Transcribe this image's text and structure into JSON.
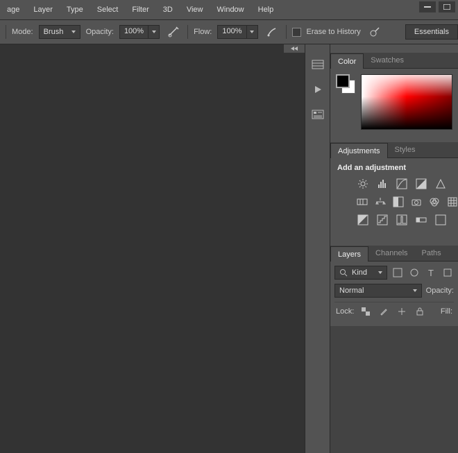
{
  "menu": {
    "items": [
      "age",
      "Layer",
      "Type",
      "Select",
      "Filter",
      "3D",
      "View",
      "Window",
      "Help"
    ]
  },
  "optbar": {
    "mode_label": "Mode:",
    "mode_value": "Brush",
    "opacity_label": "Opacity:",
    "opacity_value": "100%",
    "flow_label": "Flow:",
    "flow_value": "100%",
    "erase_label": "Erase to History",
    "workspace": "Essentials"
  },
  "panels": {
    "color_tabs": [
      "Color",
      "Swatches"
    ],
    "adj_tabs": [
      "Adjustments",
      "Styles"
    ],
    "adj_header": "Add an adjustment",
    "layer_tabs": [
      "Layers",
      "Channels",
      "Paths"
    ],
    "layers": {
      "kind_label": "Kind",
      "blend_value": "Normal",
      "opacity_label": "Opacity:",
      "lock_label": "Lock:",
      "fill_label": "Fill:"
    }
  }
}
